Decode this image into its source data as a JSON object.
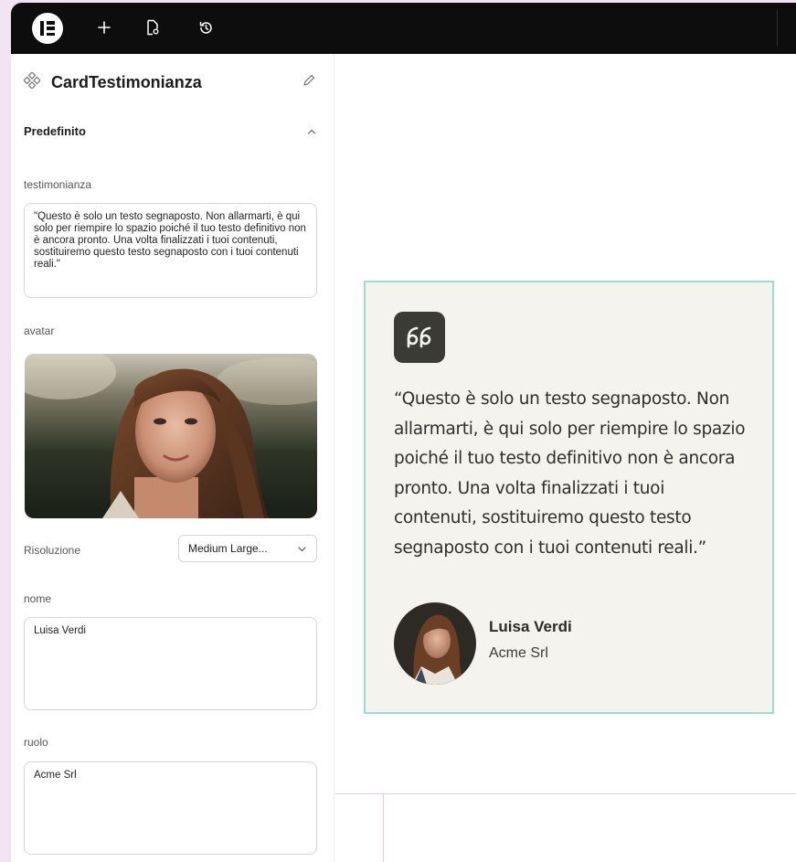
{
  "toolbar": {
    "logo_icon": "elementor-logo-icon",
    "add_icon": "plus-icon",
    "page_settings_icon": "page-settings-icon",
    "history_icon": "history-icon"
  },
  "panel": {
    "component_title": "CardTestimonianza",
    "section_title": "Predefinito",
    "testimonial_label": "testimonianza",
    "testimonial_value": "\"Questo è solo un testo segnaposto. Non allarmarti, è qui solo per riempire lo spazio poiché il tuo testo definitivo non è ancora pronto. Una volta finalizzati i tuoi contenuti, sostituiremo questo testo segnaposto con i tuoi contenuti reali.\"",
    "avatar_label": "avatar",
    "resolution_label": "Risoluzione",
    "resolution_value": "Medium Large...",
    "name_label": "nome",
    "name_value": "Luisa Verdi",
    "role_label": "ruolo",
    "role_value": "Acme Srl"
  },
  "card": {
    "quote": "“Questo è solo un testo segnaposto. Non allarmarti, è qui solo per riempire lo spazio poiché il tuo testo definitivo non è ancora pronto. Una volta finalizzati i tuoi contenuti, sostituiremo questo testo segnaposto con i tuoi contenuti reali.”",
    "author_name": "Luisa Verdi",
    "author_role": "Acme Srl"
  },
  "colors": {
    "card_border": "#9ddcd3",
    "card_bg": "#f4f3ee",
    "topbar_bg": "#0d0d0e",
    "quote_badge": "#3a3b37"
  }
}
